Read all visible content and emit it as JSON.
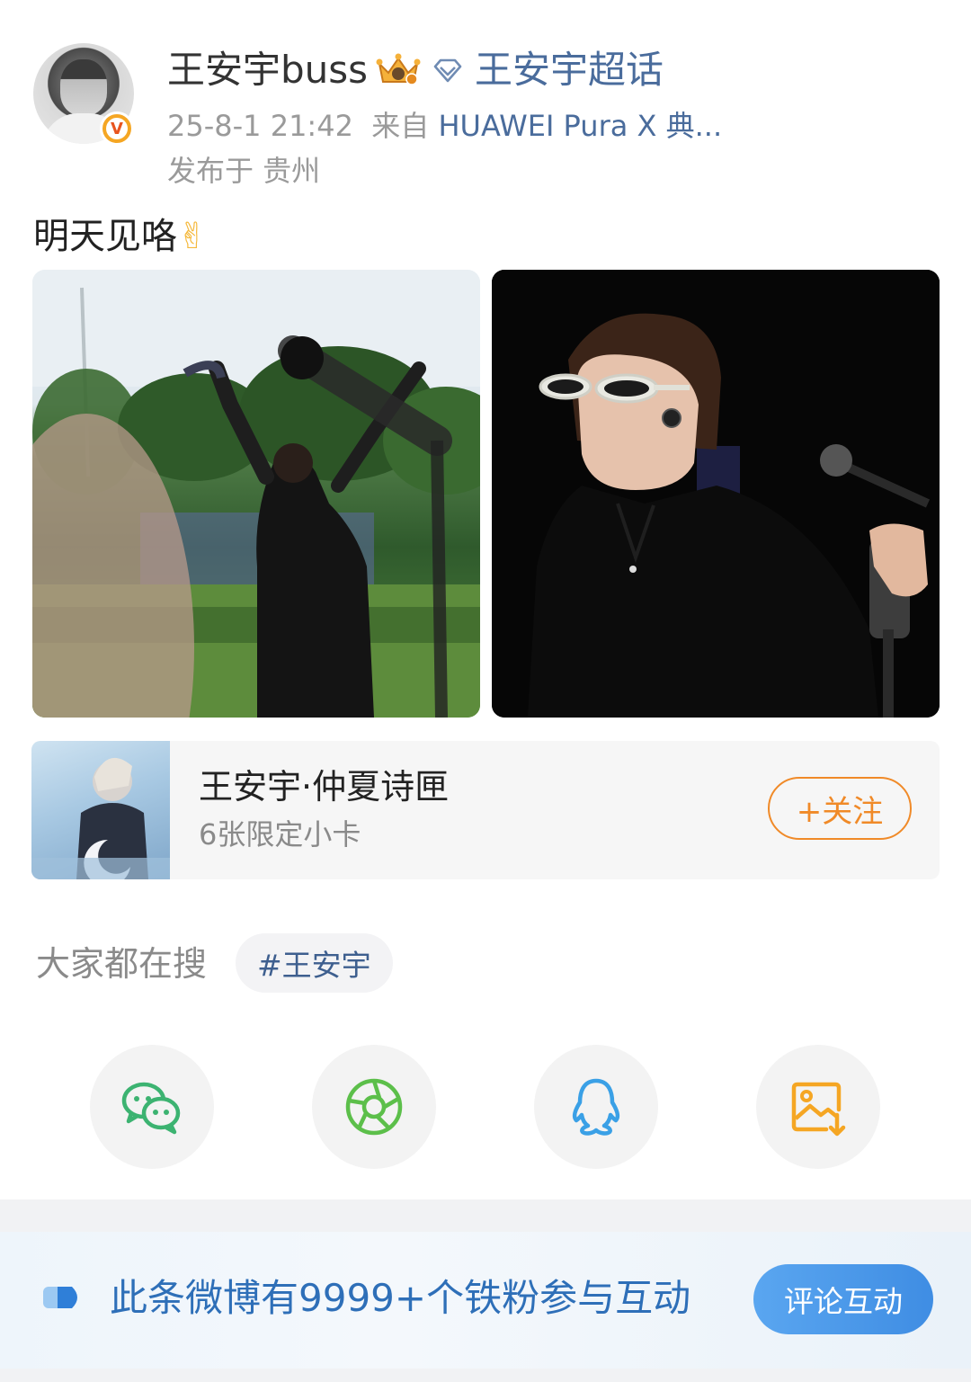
{
  "post": {
    "username": "王安宇buss",
    "topic": "王安宇超话",
    "timestamp": "25-8-1 21:42",
    "source_prefix": "来自",
    "device": "HUAWEI Pura X 典...",
    "location": "发布于 贵州",
    "text": "明天见咯",
    "emoji": "✌"
  },
  "card": {
    "title": "王安宇·仲夏诗匣",
    "subtitle": "6张限定小卡",
    "follow_label": "+关注"
  },
  "search": {
    "label": "大家都在搜",
    "tag": "#王安宇"
  },
  "share": {
    "icons": [
      "wechat-icon",
      "moments-icon",
      "qq-icon",
      "save-image-icon"
    ]
  },
  "banner": {
    "text": "此条微博有9999+个铁粉参与互动",
    "button_label": "评论互动"
  },
  "colors": {
    "link_blue": "#4a6c9c",
    "follow_orange": "#f08a28",
    "banner_blue": "#2e6fb8",
    "wechat_green": "#3cb371",
    "qq_blue": "#3aa0e6",
    "save_orange": "#f5a623"
  }
}
